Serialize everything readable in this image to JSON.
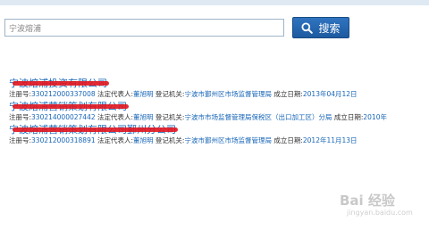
{
  "search": {
    "value": "宁波熔浦",
    "button_label": "搜索"
  },
  "labels": {
    "reg_no": "注册号:",
    "legal_rep": "法定代表人:",
    "authority": "登记机关:",
    "est_date": "成立日期:"
  },
  "results": [
    {
      "name": "宁波熔浦投资有限公司",
      "reg_no": "330212000337008",
      "legal_rep": "董旭明",
      "authority": "宁波市鄞州区市场监督管理局",
      "est_date": "2013年04月12日"
    },
    {
      "name": "宁波熔浦营销策划有限公司",
      "reg_no": "330214000027442",
      "legal_rep": "董旭明",
      "authority": "宁波市市场监督管理局保税区（出口加工区）分局",
      "est_date": "2010年"
    },
    {
      "name": "宁波熔浦营销策划有限公司鄞州分公司",
      "reg_no": "330212000318891",
      "legal_rep": "董旭明",
      "authority": "宁波市鄞州区市场监督管理局",
      "est_date": "2012年11月13日"
    }
  ],
  "watermark": {
    "brand": "Bai 经验",
    "url": "jingyan.baidu.com"
  }
}
